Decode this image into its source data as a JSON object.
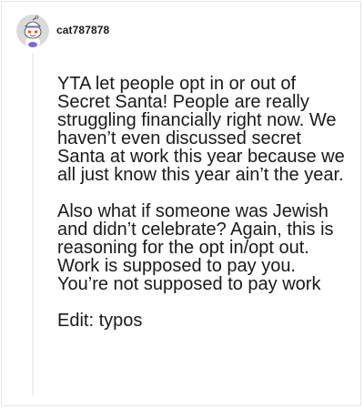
{
  "comment": {
    "username": "cat787878",
    "avatar_icon": "snoo-avatar-icon",
    "paragraphs": [
      "YTA let people opt in or out of Secret Santa! People are really struggling financially right now. We haven’t even discussed secret Santa at work this year because we all just know this year ain’t the year.",
      "Also what if someone was Jewish and didn’t celebrate? Again, this is reasoning for the opt in/opt out. Work is supposed to pay you. You’re not supposed to pay work",
      "Edit: typos"
    ]
  },
  "colors": {
    "text": "#1a1a1b",
    "border": "#e5e5e5",
    "thread_line": "#edeff1",
    "avatar_bg": "#dadada"
  }
}
